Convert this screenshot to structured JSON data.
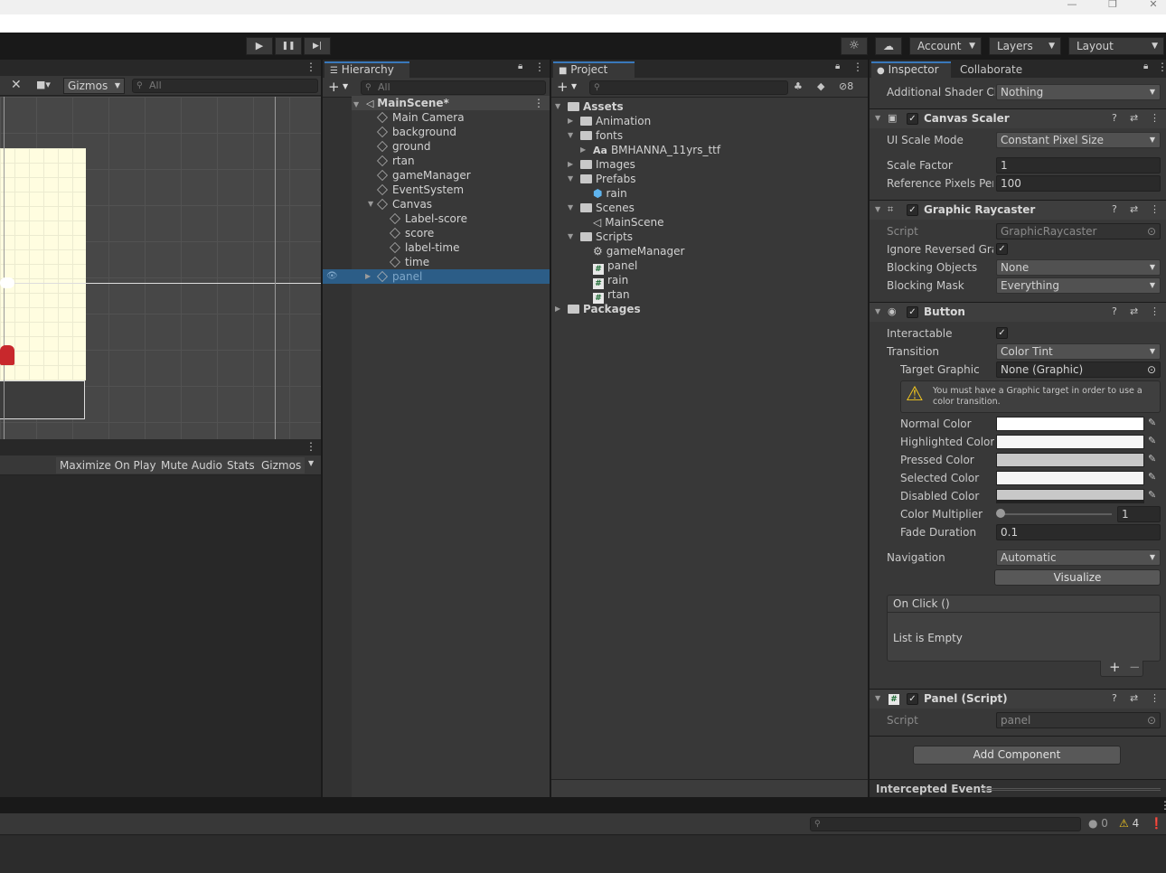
{
  "window": {
    "minimize": "—",
    "maximize": "❐",
    "close": "✕"
  },
  "toolbar": {
    "play": "▶",
    "pause": "❚❚",
    "step": "▶|",
    "account": "Account",
    "layers": "Layers",
    "layout": "Layout"
  },
  "scene": {
    "gizmos": "Gizmos",
    "search_placeholder": "All"
  },
  "game": {
    "maximize": "Maximize On Play",
    "mute": "Mute Audio",
    "stats": "Stats",
    "gizmos": "Gizmos"
  },
  "hierarchy": {
    "tab": "Hierarchy",
    "search_placeholder": "All",
    "scene": "MainScene*",
    "items": [
      {
        "label": "Main Camera",
        "indent": 1
      },
      {
        "label": "background",
        "indent": 1
      },
      {
        "label": "ground",
        "indent": 1
      },
      {
        "label": "rtan",
        "indent": 1
      },
      {
        "label": "gameManager",
        "indent": 1
      },
      {
        "label": "EventSystem",
        "indent": 1
      },
      {
        "label": "Canvas",
        "indent": 1,
        "expanded": true
      },
      {
        "label": "Label-score",
        "indent": 2
      },
      {
        "label": "score",
        "indent": 2
      },
      {
        "label": "label-time",
        "indent": 2
      },
      {
        "label": "time",
        "indent": 2
      },
      {
        "label": "panel",
        "indent": 1,
        "selected": true
      }
    ]
  },
  "project": {
    "tab": "Project",
    "hidden_count": "8",
    "items": [
      {
        "label": "Assets",
        "indent": 0,
        "kind": "folder",
        "bold": true
      },
      {
        "label": "Animation",
        "indent": 1,
        "kind": "folder"
      },
      {
        "label": "fonts",
        "indent": 1,
        "kind": "folder"
      },
      {
        "label": "BMHANNA_11yrs_ttf",
        "indent": 2,
        "kind": "font"
      },
      {
        "label": "Images",
        "indent": 1,
        "kind": "folder"
      },
      {
        "label": "Prefabs",
        "indent": 1,
        "kind": "folder"
      },
      {
        "label": "rain",
        "indent": 2,
        "kind": "prefab"
      },
      {
        "label": "Scenes",
        "indent": 1,
        "kind": "folder"
      },
      {
        "label": "MainScene",
        "indent": 2,
        "kind": "scene"
      },
      {
        "label": "Scripts",
        "indent": 1,
        "kind": "folder"
      },
      {
        "label": "gameManager",
        "indent": 2,
        "kind": "gear"
      },
      {
        "label": "panel",
        "indent": 2,
        "kind": "script"
      },
      {
        "label": "rain",
        "indent": 2,
        "kind": "script"
      },
      {
        "label": "rtan",
        "indent": 2,
        "kind": "script"
      },
      {
        "label": "Packages",
        "indent": 0,
        "kind": "folder",
        "bold": true
      }
    ]
  },
  "inspector": {
    "tab": "Inspector",
    "tab2": "Collaborate",
    "shader_label": "Additional Shader Ch",
    "shader_value": "Nothing",
    "canvas_scaler": {
      "title": "Canvas Scaler",
      "ui_scale_label": "UI Scale Mode",
      "ui_scale_value": "Constant Pixel Size",
      "scale_factor_label": "Scale Factor",
      "scale_factor_value": "1",
      "ref_pixels_label": "Reference Pixels Per",
      "ref_pixels_value": "100"
    },
    "raycaster": {
      "title": "Graphic Raycaster",
      "script_label": "Script",
      "script_value": "GraphicRaycaster",
      "ignore_label": "Ignore Reversed Grap",
      "blocking_objects_label": "Blocking Objects",
      "blocking_objects_value": "None",
      "blocking_mask_label": "Blocking Mask",
      "blocking_mask_value": "Everything"
    },
    "button": {
      "title": "Button",
      "interactable_label": "Interactable",
      "transition_label": "Transition",
      "transition_value": "Color Tint",
      "target_label": "Target Graphic",
      "target_value": "None (Graphic)",
      "warning": "You must have a Graphic target in order to use a color transition.",
      "normal": "Normal Color",
      "highlighted": "Highlighted Color",
      "pressed": "Pressed Color",
      "selected": "Selected Color",
      "disabled": "Disabled Color",
      "multiplier_label": "Color Multiplier",
      "multiplier_value": "1",
      "fade_label": "Fade Duration",
      "fade_value": "0.1",
      "navigation_label": "Navigation",
      "navigation_value": "Automatic",
      "visualize": "Visualize",
      "onclick": "On Click ()",
      "empty": "List is Empty",
      "plus": "+",
      "minus": "−"
    },
    "panel_script": {
      "title": "Panel (Script)",
      "script_label": "Script",
      "script_value": "panel"
    },
    "add_component": "Add Component",
    "intercepted": "Intercepted Events"
  },
  "console": {
    "errors": "0",
    "warnings": "4"
  }
}
